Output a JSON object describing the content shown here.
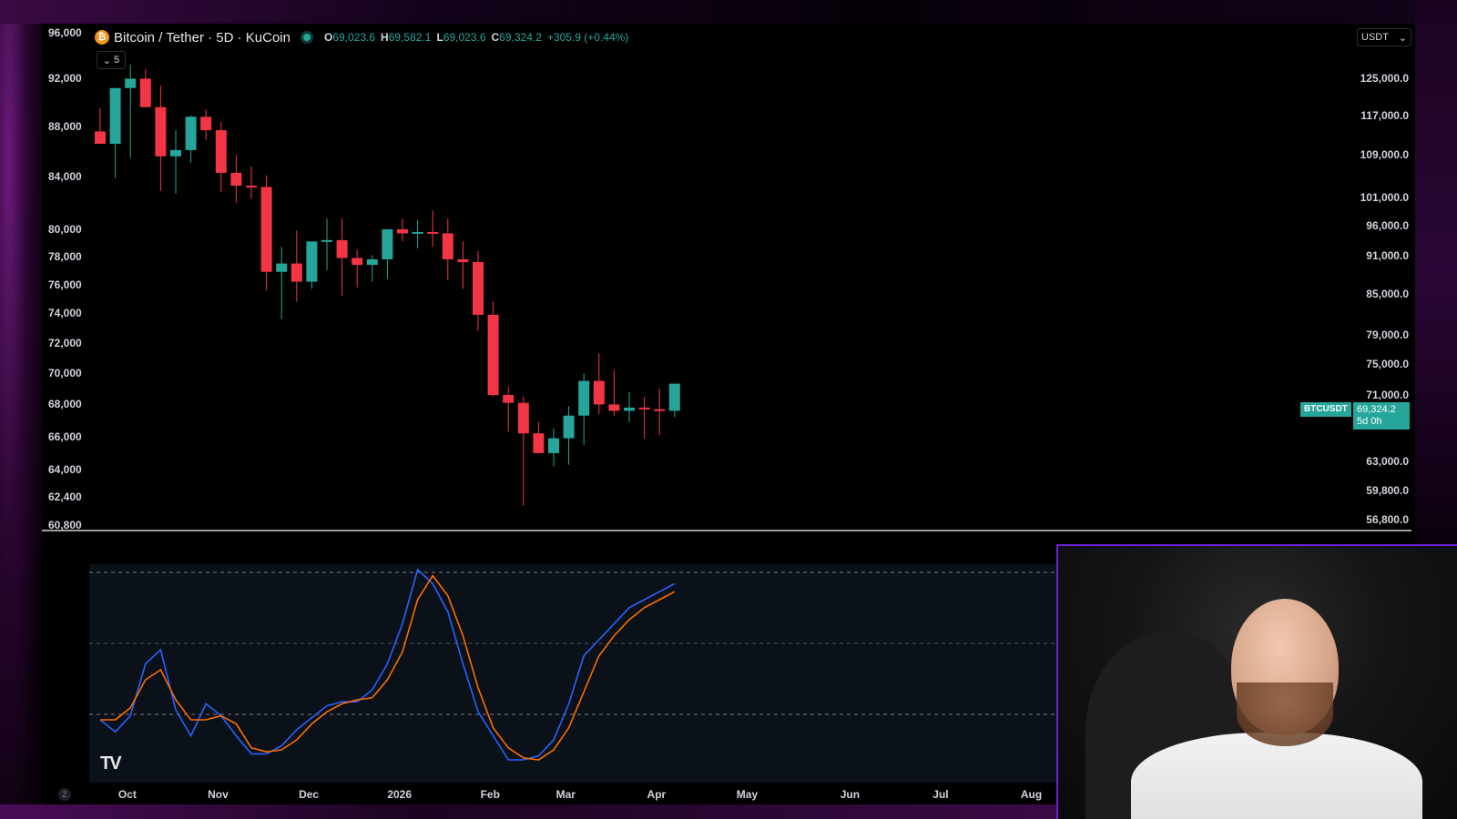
{
  "header": {
    "symbol": "Bitcoin / Tether · 5D · KuCoin",
    "coin_icon": "bitcoin-icon",
    "open_key": "O",
    "open": "69,023.6",
    "high_key": "H",
    "high": "69,582.1",
    "low_key": "L",
    "low": "69,023.6",
    "close_key": "C",
    "close": "69,324.2",
    "change": "+305.9 (+0.44%)",
    "collapse_count": "5"
  },
  "currency": "USDT",
  "left_axis": [
    "96,000",
    "92,000",
    "88,000",
    "84,000",
    "80,000",
    "78,000",
    "76,000",
    "74,000",
    "72,000",
    "70,000",
    "68,000",
    "66,000",
    "64,000",
    "62,400",
    "60,800"
  ],
  "right_axis": [
    "125,000.0",
    "117,000.0",
    "109,000.0",
    "101,000.0",
    "96,000.0",
    "91,000.0",
    "85,000.0",
    "79,000.0",
    "75,000.0",
    "71,000.0",
    "63,000.0",
    "59,800.0",
    "56,800.0"
  ],
  "price_label": {
    "symbol": "BTCUSDT",
    "price": "69,324.2",
    "countdown": "5d 0h"
  },
  "x_axis": [
    "Oct",
    "Nov",
    "Dec",
    "2026",
    "Feb",
    "Mar",
    "Apr",
    "May",
    "Jun",
    "Jul",
    "Aug"
  ],
  "logo": "TV",
  "zoom_label": "Z",
  "colors": {
    "up": "#26a69a",
    "down": "#f23645",
    "k_line": "#2962ff",
    "d_line": "#ff6d00",
    "webcam_border": "#6b1fd6"
  },
  "chart_data": [
    {
      "type": "candlestick",
      "title": "Bitcoin / Tether · 5D · KuCoin",
      "x": [
        "Sep 22",
        "Sep 27",
        "Oct 2",
        "Oct 7",
        "Oct 12",
        "Oct 17",
        "Oct 22",
        "Oct 27",
        "Nov 1",
        "Nov 6",
        "Nov 11",
        "Nov 16",
        "Nov 21",
        "Nov 26",
        "Dec 1",
        "Dec 6",
        "Dec 11",
        "Dec 16",
        "Dec 21",
        "Dec 26",
        "Dec 31",
        "Jan 5",
        "Jan 10",
        "Jan 15",
        "Jan 20",
        "Jan 25",
        "Jan 30",
        "Feb 4",
        "Feb 9",
        "Feb 14",
        "Feb 19",
        "Feb 24",
        "Mar 1",
        "Mar 6",
        "Mar 11",
        "Mar 16",
        "Mar 21",
        "Mar 26",
        "Mar 31"
      ],
      "open": [
        87600,
        86600,
        91200,
        92000,
        89600,
        85600,
        86100,
        88800,
        87700,
        84300,
        83300,
        83200,
        76900,
        77500,
        76200,
        79100,
        79200,
        77900,
        77400,
        77800,
        80000,
        79700,
        79800,
        79700,
        77800,
        77600,
        73900,
        68600,
        68100,
        66200,
        65000,
        65900,
        67300,
        69500,
        68000,
        67600,
        67800,
        67700,
        67600
      ],
      "high": [
        89500,
        89600,
        93200,
        92800,
        91400,
        87700,
        88900,
        89400,
        88400,
        85700,
        84800,
        84100,
        78700,
        79900,
        78200,
        80800,
        80800,
        78500,
        78100,
        79300,
        80800,
        80700,
        81400,
        80800,
        79100,
        78400,
        74800,
        69100,
        68500,
        66900,
        66500,
        67900,
        70000,
        71300,
        70200,
        68800,
        68500,
        69000,
        68000
      ],
      "low": [
        86800,
        83900,
        85500,
        91000,
        82900,
        82700,
        85100,
        86900,
        82800,
        82000,
        82300,
        75600,
        73600,
        74800,
        75700,
        77000,
        75200,
        75800,
        76200,
        76400,
        79100,
        78600,
        78700,
        76300,
        75700,
        72800,
        68500,
        66300,
        61900,
        65100,
        64200,
        64300,
        65500,
        67400,
        67300,
        66900,
        65900,
        66100,
        67200
      ],
      "close": [
        86600,
        91200,
        92000,
        89600,
        85600,
        86100,
        88800,
        87700,
        84300,
        83300,
        83200,
        76900,
        77500,
        76200,
        79100,
        79200,
        77900,
        77400,
        77800,
        80000,
        79700,
        79800,
        79700,
        77800,
        77600,
        73900,
        68600,
        68100,
        66200,
        65000,
        65900,
        67300,
        69500,
        68000,
        67600,
        67800,
        67700,
        67600,
        69324.2
      ]
    },
    {
      "type": "line",
      "title": "",
      "x": [
        "Sep 22",
        "Sep 27",
        "Oct 2",
        "Oct 7",
        "Oct 12",
        "Oct 17",
        "Oct 22",
        "Oct 27",
        "Nov 1",
        "Nov 6",
        "Nov 11",
        "Nov 16",
        "Nov 21",
        "Nov 26",
        "Dec 1",
        "Dec 6",
        "Dec 11",
        "Dec 16",
        "Dec 21",
        "Dec 26",
        "Dec 31",
        "Jan 5",
        "Jan 10",
        "Jan 15",
        "Jan 20",
        "Jan 25",
        "Jan 30",
        "Feb 4",
        "Feb 9",
        "Feb 14",
        "Feb 19",
        "Feb 24",
        "Mar 1",
        "Mar 6",
        "Mar 11",
        "Mar 16",
        "Mar 21",
        "Mar 26",
        "Mar 31"
      ],
      "ylim": [
        0,
        100
      ],
      "levels": [
        80,
        50,
        20
      ],
      "series": [
        {
          "values": [
            20,
            14,
            22,
            48,
            55,
            25,
            12,
            28,
            22,
            12,
            3,
            3,
            7,
            15,
            21,
            27,
            29,
            29,
            35,
            48,
            68,
            95,
            88,
            74,
            48,
            24,
            12,
            0,
            0,
            2,
            10,
            28,
            52,
            60,
            68,
            76,
            80,
            84,
            88
          ]
        },
        {
          "values": [
            20,
            20,
            26,
            40,
            45,
            30,
            20,
            20,
            22,
            18,
            6,
            4,
            5,
            10,
            18,
            24,
            28,
            30,
            31,
            40,
            54,
            80,
            92,
            82,
            62,
            36,
            16,
            6,
            1,
            0,
            5,
            16,
            34,
            52,
            62,
            70,
            76,
            80,
            84
          ]
        }
      ]
    }
  ]
}
